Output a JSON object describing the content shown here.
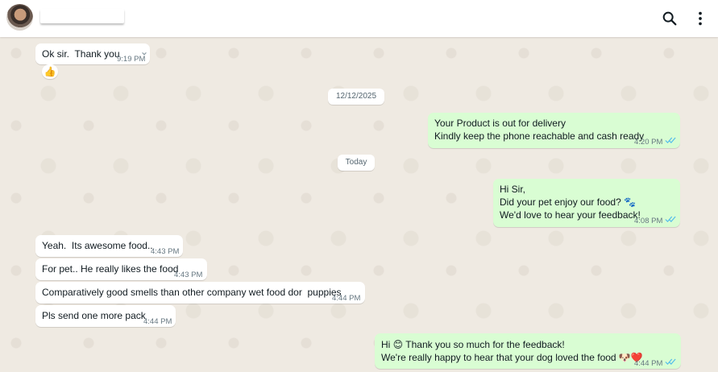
{
  "header": {
    "contact_name": "",
    "search_icon": "search-icon",
    "menu_icon": "more-vertical-icon"
  },
  "chat": {
    "date_chips": [
      "12/12/2025",
      "Today"
    ],
    "messages": [
      {
        "dir": "in",
        "text": "Ok sir.  Thank you",
        "time": "9:19 PM",
        "reaction": "👍"
      },
      {
        "dir": "out",
        "lines": [
          "Your Product is out for delivery",
          "Kindly keep the phone reachable and cash ready"
        ],
        "time": "4:20 PM",
        "status": "read"
      },
      {
        "dir": "out",
        "lines": [
          "Hi Sir,",
          "Did your pet enjoy our food? 🐾",
          "We'd love to hear your feedback!"
        ],
        "time": "4:08 PM",
        "status": "read"
      },
      {
        "dir": "in",
        "text": "Yeah.  Its awesome food..",
        "time": "4:43 PM"
      },
      {
        "dir": "in",
        "text": "For pet.. He really likes the food",
        "time": "4:43 PM"
      },
      {
        "dir": "in",
        "text": "Comparatively good smells than other company wet food dor  puppies",
        "time": "4:44 PM"
      },
      {
        "dir": "in",
        "text": "Pls send one more pack",
        "time": "4:44 PM"
      },
      {
        "dir": "out",
        "lines": [
          "Hi 😊 Thank you so much for the feedback!",
          "We're really happy to hear that your dog loved the food 🐶❤️"
        ],
        "time": "4:44 PM",
        "status": "read"
      }
    ]
  },
  "colors": {
    "incoming": "#ffffff",
    "outgoing": "#d9fdd3",
    "background": "#efeae2",
    "read_ticks": "#53bdeb"
  }
}
